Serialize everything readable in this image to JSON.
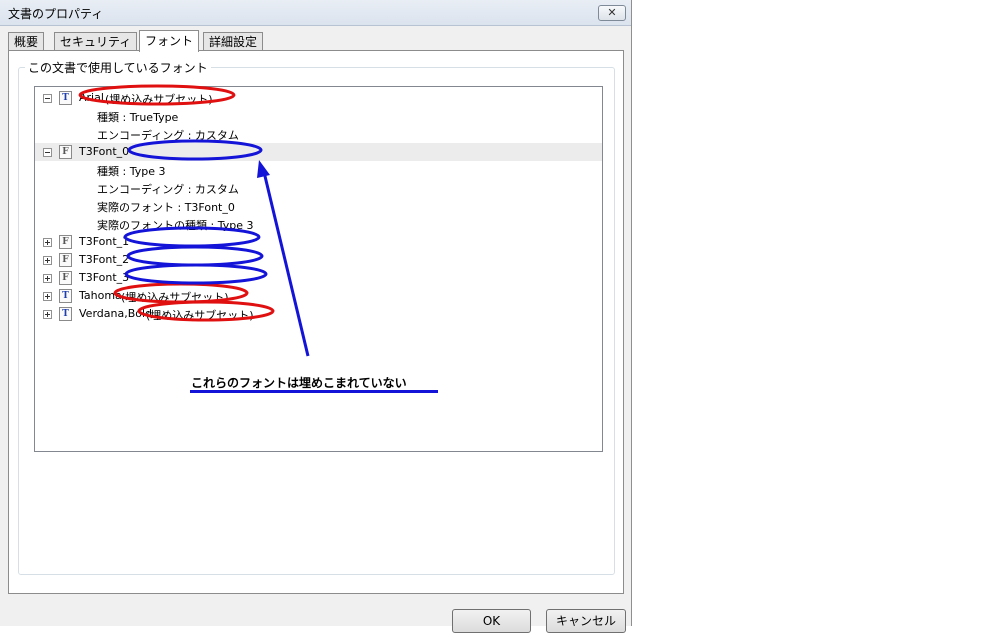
{
  "window": {
    "title": "文書のプロパティ",
    "close_glyph": "✕"
  },
  "tabs": [
    {
      "label": "概要",
      "active": false
    },
    {
      "label": "セキュリティ",
      "active": false
    },
    {
      "label": "フォント",
      "active": true
    },
    {
      "label": "詳細設定",
      "active": false
    }
  ],
  "group": {
    "label": "この文書で使用しているフォント"
  },
  "fonts": [
    {
      "name": "Arial",
      "tag": "(埋め込みサブセット)",
      "icon": "truetype-font-icon",
      "glyph": "T",
      "expanded": true,
      "expander": "−",
      "props": [
        "種類 : TrueType",
        "エンコーディング : カスタム"
      ]
    },
    {
      "name": "T3Font_0",
      "tag": "",
      "icon": "type3-font-icon",
      "glyph": "F",
      "expanded": true,
      "expander": "−",
      "selected": true,
      "props": [
        "種類 : Type 3",
        "エンコーディング : カスタム",
        "実際のフォント : T3Font_0",
        "実際のフォントの種類 : Type 3"
      ]
    },
    {
      "name": "T3Font_1",
      "tag": "",
      "icon": "type3-font-icon",
      "glyph": "F",
      "expanded": false,
      "expander": "+"
    },
    {
      "name": "T3Font_2",
      "tag": "",
      "icon": "type3-font-icon",
      "glyph": "F",
      "expanded": false,
      "expander": "+"
    },
    {
      "name": "T3Font_3",
      "tag": "",
      "icon": "type3-font-icon",
      "glyph": "F",
      "expanded": false,
      "expander": "+"
    },
    {
      "name": "Tahoma",
      "tag": "(埋め込みサブセット)",
      "icon": "truetype-font-icon",
      "glyph": "T",
      "expanded": false,
      "expander": "+"
    },
    {
      "name": "Verdana,Bold",
      "tag": "(埋め込みサブセット)",
      "icon": "truetype-font-icon",
      "glyph": "T",
      "expanded": false,
      "expander": "+"
    }
  ],
  "annotation": {
    "text": "これらのフォントは埋めこまれていない",
    "colors": {
      "embedded_marker": "#e01010",
      "not_embedded_marker": "#1414d8"
    }
  },
  "buttons": {
    "ok": "OK",
    "cancel": "キャンセル"
  }
}
